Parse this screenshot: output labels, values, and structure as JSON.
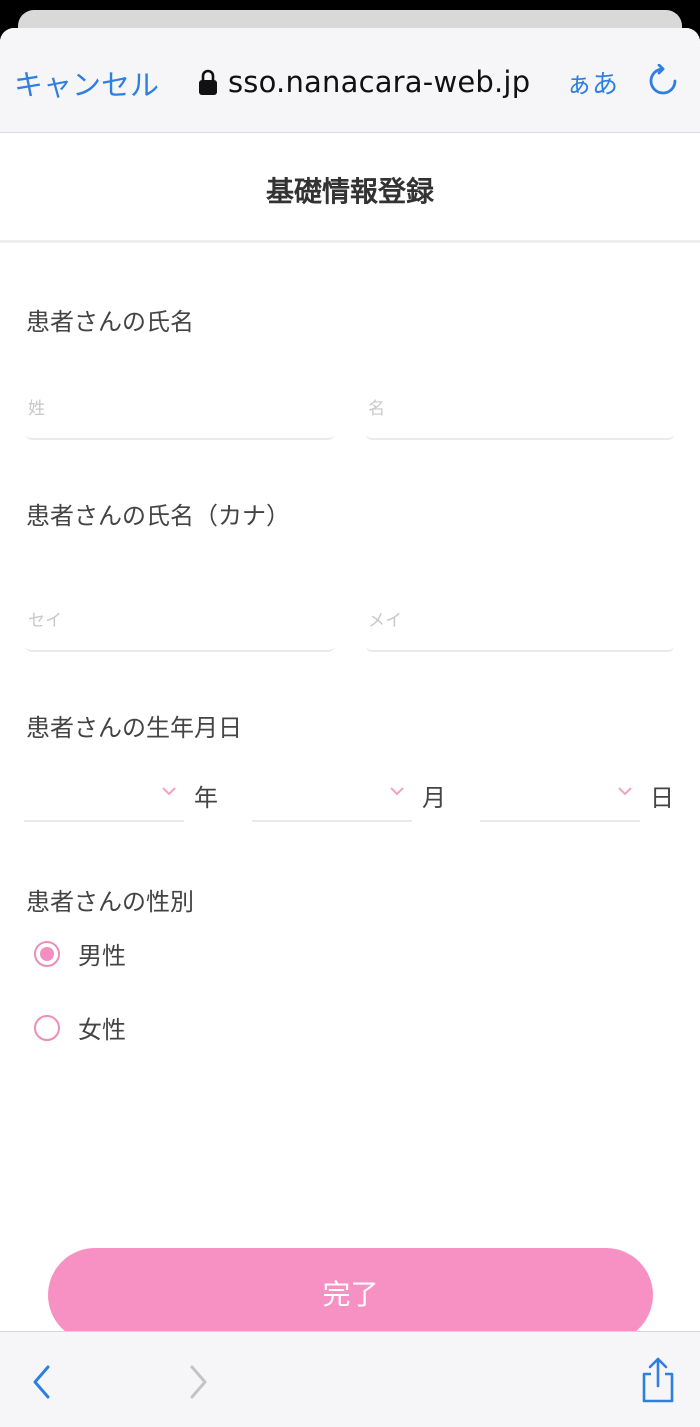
{
  "browser": {
    "cancel_label": "キャンセル",
    "url": "sso.nanacara-web.jp",
    "text_size_label": "ぁあ",
    "accent_color": "#2f7fe0"
  },
  "page": {
    "title": "基礎情報登録"
  },
  "form": {
    "name_label": "患者さんの氏名",
    "last_name_placeholder": "姓",
    "first_name_placeholder": "名",
    "kana_label": "患者さんの氏名（カナ）",
    "last_kana_placeholder": "セイ",
    "first_kana_placeholder": "メイ",
    "birthdate_label": "患者さんの生年月日",
    "year_unit": "年",
    "month_unit": "月",
    "day_unit": "日",
    "gender_label": "患者さんの性別",
    "gender_options": [
      {
        "label": "男性",
        "selected": true
      },
      {
        "label": "女性",
        "selected": false
      }
    ],
    "submit_label": "完了",
    "accent_color": "#f891c3"
  },
  "icons": {
    "lock": "lock-icon",
    "reload": "reload-icon",
    "back": "chevron-left-icon",
    "forward": "chevron-right-icon",
    "share": "share-icon",
    "select_chevron": "chevron-down-icon"
  }
}
